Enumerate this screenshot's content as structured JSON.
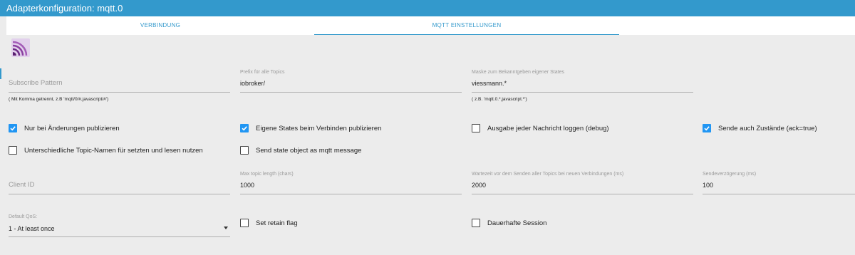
{
  "window": {
    "title": "Adapterkonfiguration: mqtt.0"
  },
  "tabs": [
    {
      "label": "VERBINDUNG",
      "active": false
    },
    {
      "label": "MQTT EINSTELLUNGEN",
      "active": true
    }
  ],
  "icons": {
    "logo": "mqtt-logo-icon",
    "dropdown": "chevron-down-icon",
    "checkmark": "check-icon"
  },
  "colors": {
    "accent": "#3399cc",
    "checkbox": "#2196f3",
    "background": "#ececec"
  },
  "fields": {
    "subscribe_pattern": {
      "placeholder": "Subscribe Pattern",
      "help": "( Mit Komma getrennt, z.B 'mqtt/0/#,javascript/#')"
    },
    "prefix": {
      "label": "Prefix für alle Topics",
      "value": "iobroker/"
    },
    "mask": {
      "label": "Maske zum Bekanntgeben eigener States",
      "value": "viessmann.*",
      "help": "( z.B. 'mqtt.0.*,javascript.*')"
    },
    "client_id": {
      "placeholder": "Client ID"
    },
    "max_topic_length": {
      "label": "Max topic length (chars)",
      "value": "1000"
    },
    "wait_time": {
      "label": "Wartezeit vor dem Senden aller Topics bei neuen Verbindungen (ms)",
      "value": "2000"
    },
    "send_delay": {
      "label": "Sendeverzögerung (ms)",
      "value": "100"
    },
    "default_qos": {
      "label": "Default QoS:",
      "value": "1 - At least once"
    }
  },
  "checkboxes": {
    "only_changes": {
      "label": "Nur bei Änderungen publizieren",
      "checked": true
    },
    "publish_own_states": {
      "label": "Eigene States beim Verbinden publizieren",
      "checked": true
    },
    "log_messages": {
      "label": "Ausgabe jeder Nachricht loggen (debug)",
      "checked": false
    },
    "send_ack_states": {
      "label": "Sende auch Zustände (ack=true)",
      "checked": true
    },
    "different_topics": {
      "label": "Unterschiedliche Topic-Namen für setzten und lesen nutzen",
      "checked": false
    },
    "send_state_object": {
      "label": "Send state object as mqtt message",
      "checked": false
    },
    "retain_flag": {
      "label": "Set retain flag",
      "checked": false
    },
    "persistent_session": {
      "label": "Dauerhafte Session",
      "checked": false
    }
  }
}
